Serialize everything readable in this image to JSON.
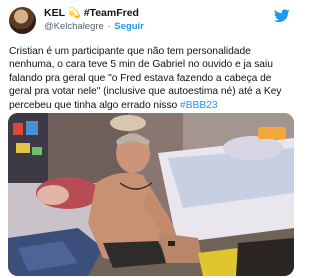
{
  "tweet": {
    "display_name": "KEL 💫 #TeamFred",
    "handle": "@Kelchalegre",
    "separator": "·",
    "follow_label": "Seguir",
    "body_text": "Cristian é um participante que não tem personalidade nenhuma, o cara teve 5 min de Gabriel no ouvido e ja saiu falando pra geral que \"o Fred estava fazendo a cabeça de geral pra votar nele\" (inclusive que autoestima né) até a Key percebeu que tinha algo errado nisso ",
    "hashtag": "#BBB23"
  },
  "icons": {
    "avatar": "profile-photo",
    "platform": "twitter-bird-icon"
  },
  "colors": {
    "accent": "#1d9bf0",
    "text": "#0f1419",
    "muted": "#536471"
  }
}
